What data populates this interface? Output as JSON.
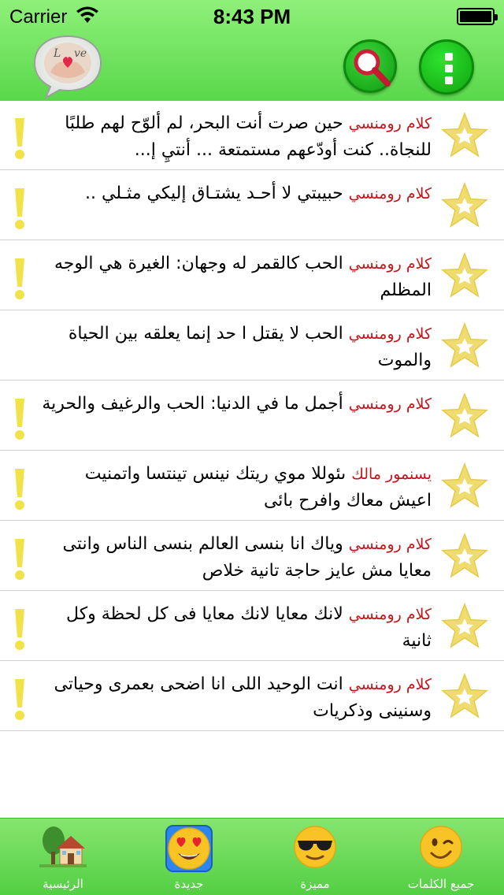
{
  "status_bar": {
    "carrier": "Carrier",
    "time": "8:43 PM"
  },
  "header": {
    "logo_icon": "love-hands-chat-logo",
    "search_icon": "magnifier-icon",
    "menu_icon": "vertical-dots-icon",
    "colors": {
      "bar": "#6be35c",
      "button": "#18b318"
    }
  },
  "list": {
    "items": [
      {
        "category": "كلام رومنسي",
        "text": "حين صرت أنت البحر، لم ألوّح لهم طلبًا للنجاة.. كنت أودّعهم مستمتعة ... أنتيِ إ...",
        "flagged": true
      },
      {
        "category": "كلام رومنسي",
        "text": "حبيبتي لا أحـد يشتـاق إليكي مثـلي ..",
        "flagged": true
      },
      {
        "category": "كلام رومنسي",
        "text": "الحب كالقمر له وجهان: الغيرة هي الوجه المظلم",
        "flagged": true
      },
      {
        "category": "كلام رومنسي",
        "text": "الحب لا يقتل ا حد إنما يعلقه بين الحياة والموت",
        "flagged": false
      },
      {
        "category": "كلام رومنسي",
        "text": "أجمل ما في الدنيا: الحب والرغيف والحرية",
        "flagged": true
      },
      {
        "category": "يسنمور مالك",
        "text": "ىئوللا موي ريتك نينس تينتسا واتمنيت اعيش معاك وافرح بائى",
        "flagged": true
      },
      {
        "category": "كلام رومنسي",
        "text": "وياك انا بنسى العالم بنسى الناس وانتى معايا مش عايز حاجة تانية خلاص",
        "flagged": true
      },
      {
        "category": "كلام رومنسي",
        "text": "لانك معايا لانك معايا فى كل لحظة وكل ثانية",
        "flagged": true
      },
      {
        "category": "كلام رومنسي",
        "text": "انت الوحيد اللى انا اضحى بعمرى وحياتى وسنينى وذكريات",
        "flagged": true
      }
    ],
    "favorite_icon": "star-icon",
    "flag_icon": "exclamation-icon",
    "colors": {
      "category": "#c3151a",
      "star": "#f0dc6e",
      "flag": "#f2e24a"
    }
  },
  "tabs": [
    {
      "label": "الرئيسية",
      "icon": "house-icon"
    },
    {
      "label": "جديدة",
      "icon": "heart-eyes-emoji-icon",
      "selected": true
    },
    {
      "label": "مميزة",
      "icon": "sunglasses-emoji-icon"
    },
    {
      "label": "جميع الكلمات",
      "icon": "wink-emoji-icon"
    }
  ]
}
